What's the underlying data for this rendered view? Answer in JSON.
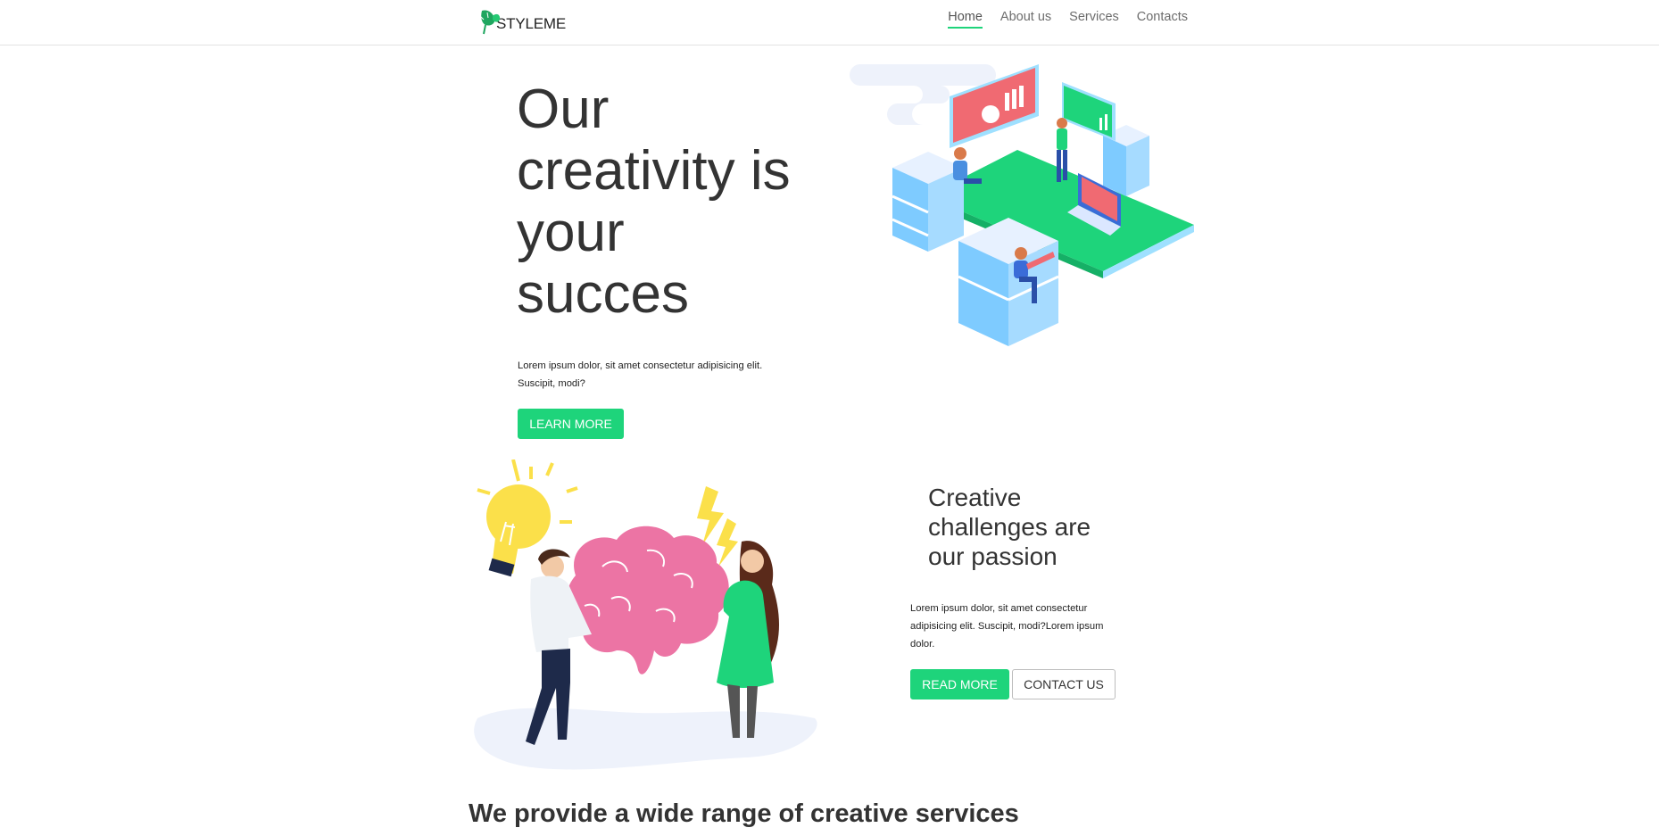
{
  "header": {
    "logo_text": "STYLEME",
    "nav": [
      {
        "label": "Home",
        "active": true
      },
      {
        "label": "About us",
        "active": false
      },
      {
        "label": "Services",
        "active": false
      },
      {
        "label": "Contacts",
        "active": false
      }
    ]
  },
  "hero": {
    "title": "Our creativity is your succes",
    "text": "Lorem ipsum dolor, sit amet consectetur adipisicing elit. Suscipit, modi?",
    "button_label": "LEARN MORE"
  },
  "creative": {
    "title": "Creative challenges are our passion",
    "text": "Lorem ipsum dolor, sit amet consectetur adipisicing elit. Suscipit, modi?Lorem ipsum dolor.",
    "read_more_label": "READ MORE",
    "contact_label": "CONTACT US"
  },
  "services": {
    "title": "We provide a wide range of creative services"
  },
  "colors": {
    "accent": "#1ed47b",
    "text": "#333333",
    "nav_text": "#6d6d6d"
  }
}
